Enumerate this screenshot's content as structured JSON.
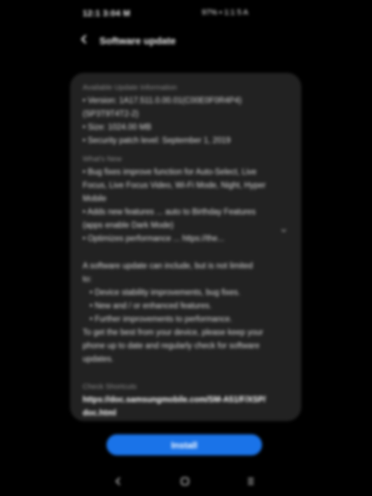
{
  "status_bar": {
    "time": "12:1 3:04 M",
    "right_text": "97% ▪ 1:1 5 A"
  },
  "header": {
    "back_icon": "back-arrow-icon",
    "title": "Software update"
  },
  "card": {
    "section1_label": "Available Update Information",
    "section1_lines": [
      "• Version: 1A17.511.0.00.01(C00E0F0R4P4)",
      "  (SP3T9T4T2-2)",
      "• Size: 1024.00 MB",
      "• Security patch level: September 1, 2019"
    ],
    "section2_label": "What's New",
    "section2_lines": [
      "• Bug fixes improve function for Auto-Select, Live",
      "  Focus, Live Focus Video, Wi-Fi Mode, Night, Hyper",
      "  Mobile",
      "• Adds new features ... auto to Birthday Features",
      "  (apps enable Dark Mode)",
      "• Optimizes performance ... https://the..."
    ],
    "section3_intro": [
      "A software update can include, but is not limited",
      "to:"
    ],
    "section3_bullets": [
      "• Device stability improvements, bug fixes.",
      "• New and / or enhanced features.",
      "• Further improvements to performance."
    ],
    "section3_outro": [
      "To get the best from your device, please keep your",
      "phone up to date and regularly check for software",
      "updates."
    ],
    "section4_label": "Check Shortcuts",
    "section4_link": [
      "https://doc.samsungmobile.com/SM-A51/F/XSP/",
      "doc.html"
    ]
  },
  "actions": {
    "update_label": "Install"
  },
  "nav_bar": {
    "back_icon": "nav-back-icon",
    "home_icon": "nav-home-icon",
    "recents_icon": "nav-recents-icon"
  }
}
